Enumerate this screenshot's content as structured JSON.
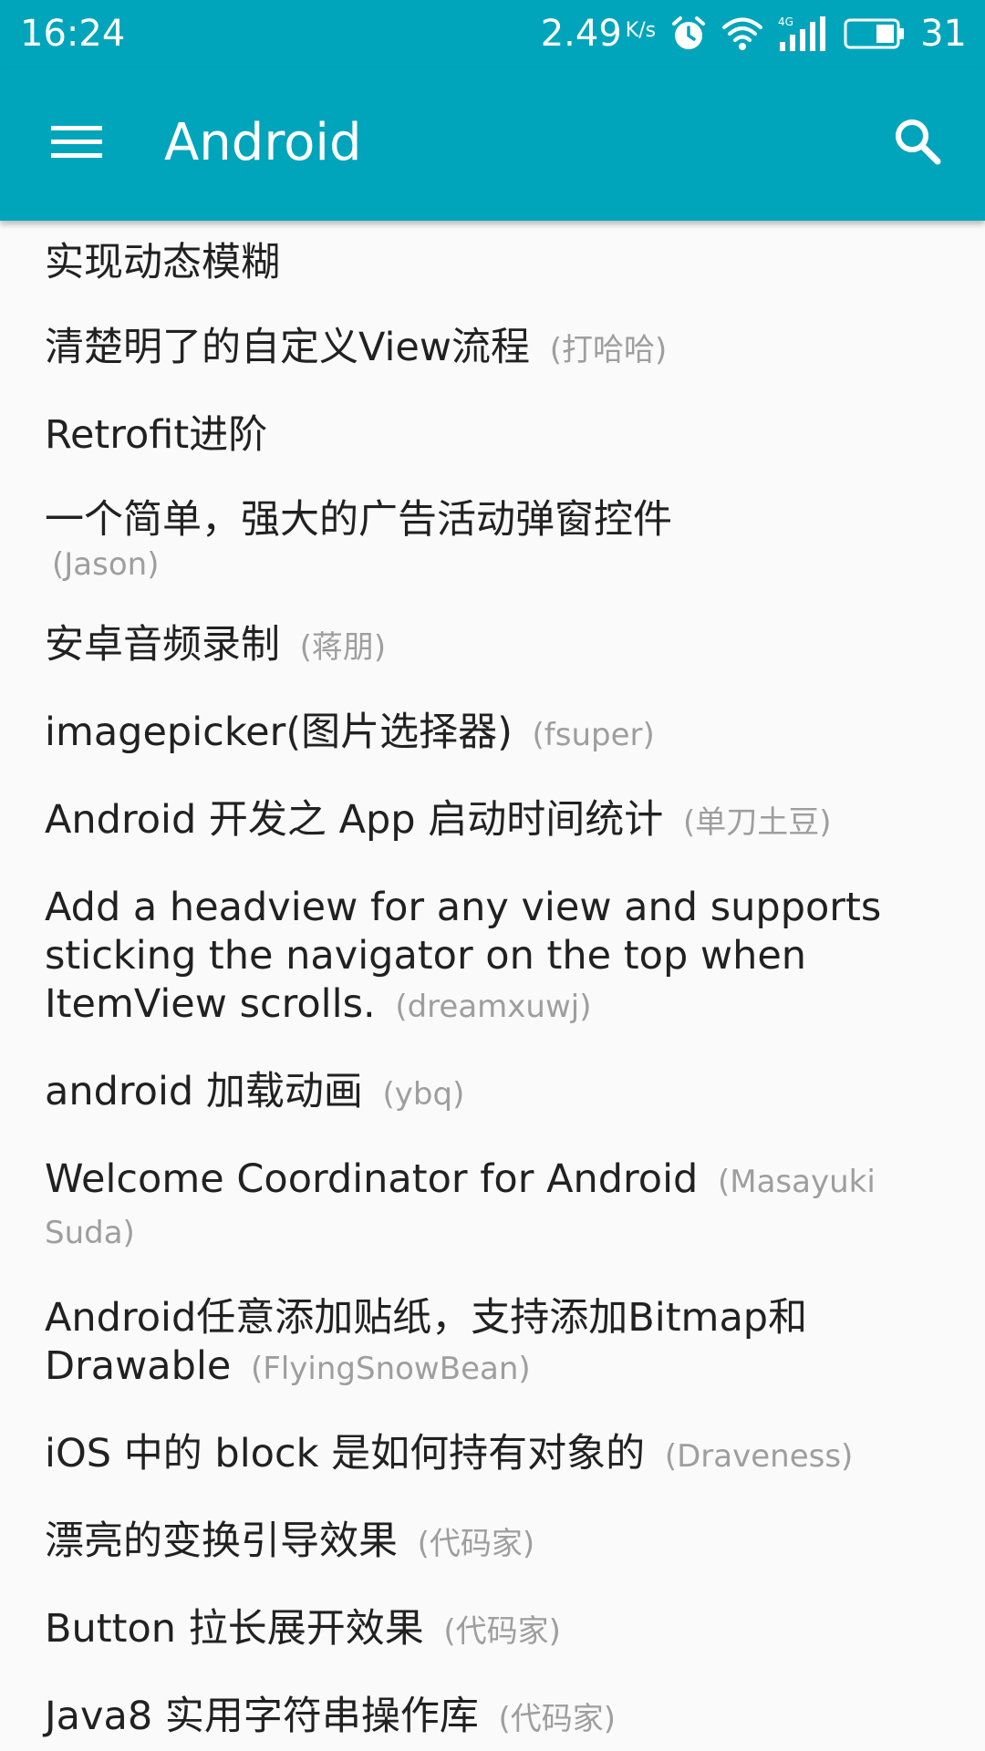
{
  "status_bar": {
    "time": "16:24",
    "net_speed": "2.49",
    "net_speed_unit": "K/s",
    "battery_level": "31",
    "icons": [
      "alarm-icon",
      "wifi-icon",
      "4g-signal-icon",
      "battery-icon"
    ]
  },
  "app_bar": {
    "title": "Android",
    "menu_icon": "menu-icon",
    "search_icon": "search-icon",
    "color": "#00a5bb"
  },
  "articles": [
    {
      "title": "实现动态模糊",
      "author": ""
    },
    {
      "title": "清楚明了的自定义View流程",
      "author": "(打哈哈)"
    },
    {
      "title": "Retrofit进阶",
      "author": ""
    },
    {
      "title": "一个简单，强大的广告活动弹窗控件",
      "author": "(Jason)"
    },
    {
      "title": "安卓音频录制",
      "author": "(蒋朋)"
    },
    {
      "title": "imagepicker(图片选择器)",
      "author": "(fsuper)"
    },
    {
      "title": "Android 开发之 App 启动时间统计",
      "author": "(单刀土豆)"
    },
    {
      "title": "Add a headview for any view and supports sticking the navigator on the top when ItemView scrolls.",
      "author": "(dreamxuwj)"
    },
    {
      "title": "android 加载动画",
      "author": "(ybq)"
    },
    {
      "title": "Welcome Coordinator for Android",
      "author": "(Masayuki Suda)"
    },
    {
      "title": "Android任意添加贴纸，支持添加Bitmap和Drawable",
      "author": "(FlyingSnowBean)"
    },
    {
      "title": "iOS 中的 block 是如何持有对象的",
      "author": "(Draveness)"
    },
    {
      "title": "漂亮的变换引导效果",
      "author": "(代码家)"
    },
    {
      "title": "Button 拉长展开效果",
      "author": "(代码家)"
    },
    {
      "title": "Java8 实用字符串操作库",
      "author": "(代码家)"
    }
  ]
}
